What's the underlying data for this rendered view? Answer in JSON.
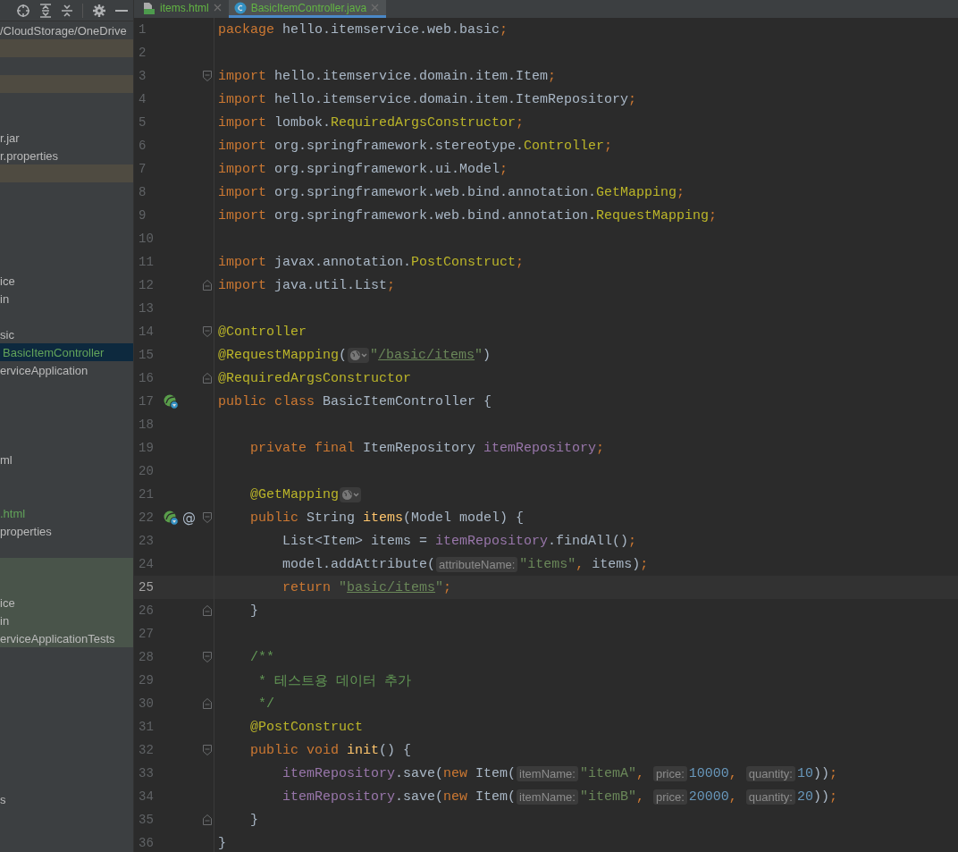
{
  "toolbar": {
    "icons": [
      {
        "kind": "locate"
      },
      {
        "kind": "expand"
      },
      {
        "kind": "collapse"
      },
      {
        "kind": "separator"
      },
      {
        "kind": "settings"
      },
      {
        "kind": "minimize"
      }
    ]
  },
  "project_tree": {
    "path": "/CloudStorage/OneDrive",
    "rows": [
      {
        "selected": false,
        "kind": "excluded"
      },
      {
        "selected": false,
        "kind": "plain"
      },
      {
        "selected": false,
        "kind": "excluded"
      },
      {
        "selected": false,
        "kind": "plain"
      },
      {
        "selected": false,
        "kind": "plain"
      },
      {
        "label": "r.jar",
        "color": "#bbbbbb",
        "selected": false,
        "kind": "plain"
      },
      {
        "label": "r.properties",
        "color": "#bbbbbb",
        "selected": false,
        "kind": "plain"
      },
      {
        "selected": false,
        "kind": "excluded"
      },
      {
        "selected": false,
        "kind": "plain"
      },
      {
        "selected": false,
        "kind": "plain"
      },
      {
        "selected": false,
        "kind": "plain"
      },
      {
        "selected": false,
        "kind": "plain"
      },
      {
        "selected": false,
        "kind": "plain"
      },
      {
        "label": "ice",
        "color": "#bbbbbb",
        "selected": false,
        "kind": "plain"
      },
      {
        "label": "in",
        "color": "#bbbbbb",
        "selected": false,
        "kind": "plain"
      },
      {
        "selected": false,
        "kind": "plain"
      },
      {
        "label": "sic",
        "color": "#bbbbbb",
        "selected": false,
        "kind": "plain"
      },
      {
        "label": "BasicItemController",
        "color": "#62a35a",
        "selected": true,
        "kind": "plain"
      },
      {
        "label": "erviceApplication",
        "color": "#bbbbbb",
        "selected": false,
        "kind": "plain"
      },
      {
        "selected": false,
        "kind": "plain"
      },
      {
        "selected": false,
        "kind": "plain"
      },
      {
        "selected": false,
        "kind": "plain"
      },
      {
        "selected": false,
        "kind": "plain"
      },
      {
        "label": "ml",
        "color": "#bbbbbb",
        "selected": false,
        "kind": "plain"
      },
      {
        "selected": false,
        "kind": "plain"
      },
      {
        "selected": false,
        "kind": "plain"
      },
      {
        "label": ".html",
        "color": "#62a35a",
        "selected": false,
        "kind": "plain"
      },
      {
        "label": "properties",
        "color": "#bbbbbb",
        "selected": false,
        "kind": "plain"
      },
      {
        "selected": false,
        "kind": "plain"
      },
      {
        "selected": false,
        "kind": "test"
      },
      {
        "selected": false,
        "kind": "test"
      },
      {
        "label": "ice",
        "color": "#bbbbbb",
        "selected": false,
        "kind": "test"
      },
      {
        "label": "in",
        "color": "#bbbbbb",
        "selected": false,
        "kind": "test"
      },
      {
        "label": "erviceApplicationTests",
        "color": "#bbbbbb",
        "selected": false,
        "kind": "test"
      },
      {
        "selected": false,
        "kind": "plain"
      },
      {
        "selected": false,
        "kind": "plain"
      },
      {
        "selected": false,
        "kind": "plain"
      },
      {
        "selected": false,
        "kind": "plain"
      },
      {
        "selected": false,
        "kind": "plain"
      },
      {
        "selected": false,
        "kind": "plain"
      },
      {
        "selected": false,
        "kind": "plain"
      },
      {
        "selected": false,
        "kind": "plain"
      },
      {
        "label": "s",
        "color": "#bbbbbb",
        "selected": false,
        "kind": "plain"
      }
    ]
  },
  "tabs": [
    {
      "label": "items.html",
      "kind": "html",
      "selected": false
    },
    {
      "label": "BasicItemController.java",
      "kind": "class",
      "selected": true
    }
  ],
  "editor": {
    "lines": [
      {
        "number": "1",
        "current": false,
        "tokens": [
          {
            "kind": "kw",
            "text": "package"
          },
          {
            "kind": "plain",
            "text": " hello.itemservice.web.basic"
          },
          {
            "kind": "kw",
            "text": ";"
          }
        ]
      },
      {
        "number": "2",
        "current": false
      },
      {
        "number": "3",
        "current": false,
        "fold": {
          "kind": "start"
        },
        "tokens": [
          {
            "kind": "kw",
            "text": "import"
          },
          {
            "kind": "plain",
            "text": " hello.itemservice.domain.item.Item"
          },
          {
            "kind": "kw",
            "text": ";"
          }
        ]
      },
      {
        "number": "4",
        "current": false,
        "tokens": [
          {
            "kind": "kw",
            "text": "import"
          },
          {
            "kind": "plain",
            "text": " hello.itemservice.domain.item.ItemRepository"
          },
          {
            "kind": "kw",
            "text": ";"
          }
        ]
      },
      {
        "number": "5",
        "current": false,
        "tokens": [
          {
            "kind": "kw",
            "text": "import"
          },
          {
            "kind": "plain",
            "text": " lombok."
          },
          {
            "kind": "ann",
            "text": "RequiredArgsConstructor"
          },
          {
            "kind": "kw",
            "text": ";"
          }
        ]
      },
      {
        "number": "6",
        "current": false,
        "tokens": [
          {
            "kind": "kw",
            "text": "import"
          },
          {
            "kind": "plain",
            "text": " org.springframework.stereotype."
          },
          {
            "kind": "ann",
            "text": "Controller"
          },
          {
            "kind": "kw",
            "text": ";"
          }
        ]
      },
      {
        "number": "7",
        "current": false,
        "tokens": [
          {
            "kind": "kw",
            "text": "import"
          },
          {
            "kind": "plain",
            "text": " org.springframework.ui.Model"
          },
          {
            "kind": "kw",
            "text": ";"
          }
        ]
      },
      {
        "number": "8",
        "current": false,
        "tokens": [
          {
            "kind": "kw",
            "text": "import"
          },
          {
            "kind": "plain",
            "text": " org.springframework.web.bind.annotation."
          },
          {
            "kind": "ann",
            "text": "GetMapping"
          },
          {
            "kind": "kw",
            "text": ";"
          }
        ]
      },
      {
        "number": "9",
        "current": false,
        "tokens": [
          {
            "kind": "kw",
            "text": "import"
          },
          {
            "kind": "plain",
            "text": " org.springframework.web.bind.annotation."
          },
          {
            "kind": "ann",
            "text": "RequestMapping"
          },
          {
            "kind": "kw",
            "text": ";"
          }
        ]
      },
      {
        "number": "10",
        "current": false
      },
      {
        "number": "11",
        "current": false,
        "tokens": [
          {
            "kind": "kw",
            "text": "import"
          },
          {
            "kind": "plain",
            "text": " javax.annotation."
          },
          {
            "kind": "ann",
            "text": "PostConstruct"
          },
          {
            "kind": "kw",
            "text": ";"
          }
        ]
      },
      {
        "number": "12",
        "current": false,
        "fold": {
          "kind": "end"
        },
        "tokens": [
          {
            "kind": "kw",
            "text": "import"
          },
          {
            "kind": "plain",
            "text": " java.util.List"
          },
          {
            "kind": "kw",
            "text": ";"
          }
        ]
      },
      {
        "number": "13",
        "current": false
      },
      {
        "number": "14",
        "current": false,
        "fold": {
          "kind": "start"
        },
        "tokens": [
          {
            "kind": "ann",
            "text": "@Controller"
          }
        ]
      },
      {
        "number": "15",
        "current": false,
        "tokens": [
          {
            "kind": "ann",
            "text": "@RequestMapping"
          },
          {
            "kind": "plain",
            "text": "("
          },
          {
            "kind": "globe"
          },
          {
            "kind": "str",
            "text": "\""
          },
          {
            "kind": "url",
            "text": "/basic/items"
          },
          {
            "kind": "str",
            "text": "\""
          },
          {
            "kind": "plain",
            "text": ")"
          }
        ]
      },
      {
        "number": "16",
        "current": false,
        "fold": {
          "kind": "end"
        },
        "tokens": [
          {
            "kind": "ann",
            "text": "@RequiredArgsConstructor"
          }
        ]
      },
      {
        "number": "17",
        "current": false,
        "gutter": [
          {
            "kind": "bean"
          }
        ],
        "tokens": [
          {
            "kind": "kw",
            "text": "public class"
          },
          {
            "kind": "plain",
            "text": " BasicItemController {"
          }
        ]
      },
      {
        "number": "18",
        "current": false
      },
      {
        "number": "19",
        "current": false,
        "tokens": [
          {
            "kind": "kw",
            "text": "    private final"
          },
          {
            "kind": "plain",
            "text": " ItemRepository "
          },
          {
            "kind": "field",
            "text": "itemRepository"
          },
          {
            "kind": "kw",
            "text": ";"
          }
        ]
      },
      {
        "number": "20",
        "current": false
      },
      {
        "number": "21",
        "current": false,
        "tokens": [
          {
            "kind": "ann",
            "text": "    @GetMapping"
          },
          {
            "kind": "globe"
          }
        ]
      },
      {
        "number": "22",
        "current": false,
        "fold": {
          "kind": "start"
        },
        "gutter": [
          {
            "kind": "bean"
          },
          {
            "kind": "symbol",
            "text": "@"
          }
        ],
        "tokens": [
          {
            "kind": "kw",
            "text": "    public"
          },
          {
            "kind": "plain",
            "text": " String "
          },
          {
            "kind": "fn",
            "text": "items"
          },
          {
            "kind": "plain",
            "text": "(Model model) {"
          }
        ]
      },
      {
        "number": "23",
        "current": false,
        "tokens": [
          {
            "kind": "plain",
            "text": "        List<Item> items = "
          },
          {
            "kind": "field",
            "text": "itemRepository"
          },
          {
            "kind": "plain",
            "text": ".findAll()"
          },
          {
            "kind": "kw",
            "text": ";"
          }
        ]
      },
      {
        "number": "24",
        "current": false,
        "tokens": [
          {
            "kind": "plain",
            "text": "        model.addAttribute("
          },
          {
            "kind": "hint",
            "text": "attributeName:"
          },
          {
            "kind": "str",
            "text": "\"items\""
          },
          {
            "kind": "kw",
            "text": ","
          },
          {
            "kind": "plain",
            "text": " items)"
          },
          {
            "kind": "kw",
            "text": ";"
          }
        ]
      },
      {
        "number": "25",
        "current": true,
        "tokens": [
          {
            "kind": "kw",
            "text": "        return "
          },
          {
            "kind": "str",
            "text": "\""
          },
          {
            "kind": "url",
            "text": "basic/items"
          },
          {
            "kind": "str",
            "text": "\""
          },
          {
            "kind": "kw",
            "text": ";"
          }
        ]
      },
      {
        "number": "26",
        "current": false,
        "fold": {
          "kind": "end"
        },
        "tokens": [
          {
            "kind": "plain",
            "text": "    }"
          }
        ]
      },
      {
        "number": "27",
        "current": false
      },
      {
        "number": "28",
        "current": false,
        "fold": {
          "kind": "start"
        },
        "tokens": [
          {
            "kind": "doc",
            "text": "    /**"
          }
        ]
      },
      {
        "number": "29",
        "current": false,
        "tokens": [
          {
            "kind": "doc",
            "text": "     * 테스트용 데이터 추가"
          }
        ]
      },
      {
        "number": "30",
        "current": false,
        "fold": {
          "kind": "end"
        },
        "tokens": [
          {
            "kind": "doc",
            "text": "     */"
          }
        ]
      },
      {
        "number": "31",
        "current": false,
        "tokens": [
          {
            "kind": "ann",
            "text": "    @PostConstruct"
          }
        ]
      },
      {
        "number": "32",
        "current": false,
        "fold": {
          "kind": "start"
        },
        "tokens": [
          {
            "kind": "kw",
            "text": "    public void "
          },
          {
            "kind": "fn",
            "text": "init"
          },
          {
            "kind": "plain",
            "text": "() {"
          }
        ]
      },
      {
        "number": "33",
        "current": false,
        "tokens": [
          {
            "kind": "field",
            "text": "        itemRepository"
          },
          {
            "kind": "plain",
            "text": ".save("
          },
          {
            "kind": "kw",
            "text": "new"
          },
          {
            "kind": "plain",
            "text": " Item("
          },
          {
            "kind": "hint",
            "text": "itemName:"
          },
          {
            "kind": "str",
            "text": "\"itemA\""
          },
          {
            "kind": "kw",
            "text": ", "
          },
          {
            "kind": "hint",
            "text": "price:"
          },
          {
            "kind": "num",
            "text": "10000"
          },
          {
            "kind": "kw",
            "text": ", "
          },
          {
            "kind": "hint",
            "text": "quantity:"
          },
          {
            "kind": "num",
            "text": "10"
          },
          {
            "kind": "plain",
            "text": "))"
          },
          {
            "kind": "kw",
            "text": ";"
          }
        ]
      },
      {
        "number": "34",
        "current": false,
        "tokens": [
          {
            "kind": "field",
            "text": "        itemRepository"
          },
          {
            "kind": "plain",
            "text": ".save("
          },
          {
            "kind": "kw",
            "text": "new"
          },
          {
            "kind": "plain",
            "text": " Item("
          },
          {
            "kind": "hint",
            "text": "itemName:"
          },
          {
            "kind": "str",
            "text": "\"itemB\""
          },
          {
            "kind": "kw",
            "text": ", "
          },
          {
            "kind": "hint",
            "text": "price:"
          },
          {
            "kind": "num",
            "text": "20000"
          },
          {
            "kind": "kw",
            "text": ", "
          },
          {
            "kind": "hint",
            "text": "quantity:"
          },
          {
            "kind": "num",
            "text": "20"
          },
          {
            "kind": "plain",
            "text": "))"
          },
          {
            "kind": "kw",
            "text": ";"
          }
        ]
      },
      {
        "number": "35",
        "current": false,
        "fold": {
          "kind": "end"
        },
        "tokens": [
          {
            "kind": "plain",
            "text": "    }"
          }
        ]
      },
      {
        "number": "36",
        "current": false,
        "tokens": [
          {
            "kind": "plain",
            "text": "}"
          }
        ]
      }
    ]
  }
}
